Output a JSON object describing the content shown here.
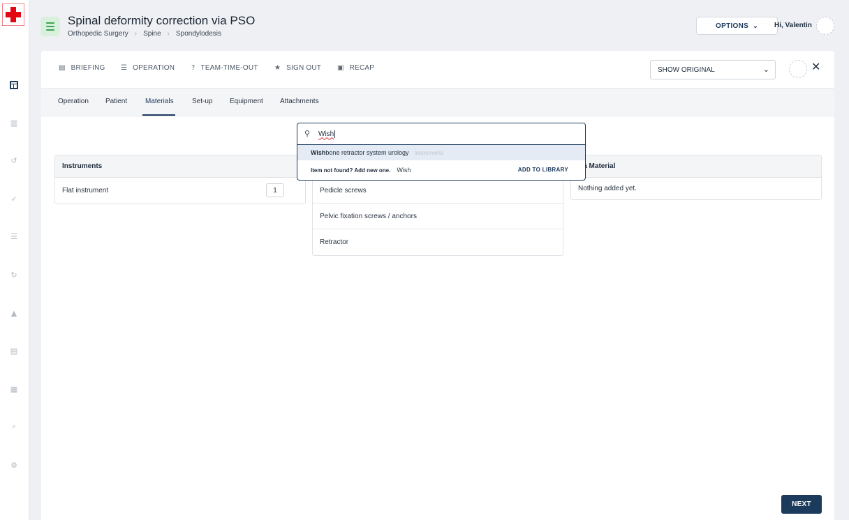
{
  "app": {
    "title": "Spinal deformity correction via PSO",
    "breadcrumbs": [
      "Orthopedic Surgery",
      "Spine",
      "Spondylodesis"
    ],
    "options_label": "OPTIONS",
    "greeting": "Hi, Valentin",
    "brand_color": "#e30613",
    "accent_color": "#1b3a5c"
  },
  "rail": {
    "icons": [
      "dashboard-icon",
      "library-icon",
      "history-icon",
      "checklist-icon",
      "tasks-icon",
      "review-icon",
      "warning-icon",
      "stats-icon",
      "calendar-icon",
      "search-list-icon",
      "settings-icon"
    ]
  },
  "phases": [
    {
      "label": "BRIEFING",
      "icon": "document-icon"
    },
    {
      "label": "OPERATION",
      "icon": "list-icon"
    },
    {
      "label": "TEAM-TIME-OUT",
      "icon": "help-icon"
    },
    {
      "label": "SIGN OUT",
      "icon": "star-icon"
    },
    {
      "label": "RECAP",
      "icon": "recap-icon"
    }
  ],
  "view_select": {
    "value": "SHOW ORIGINAL"
  },
  "tabs": [
    {
      "label": "Operation"
    },
    {
      "label": "Patient"
    },
    {
      "label": "Materials",
      "active": true
    },
    {
      "label": "Set-up"
    },
    {
      "label": "Equipment"
    },
    {
      "label": "Attachments"
    }
  ],
  "search": {
    "value": "Wish",
    "suggestion": {
      "match": "Wish",
      "rest": "bone retractor system urology",
      "category": "Instruments"
    },
    "not_found_label": "Item not found? Add new one.",
    "not_found_term": "Wish",
    "add_label": "ADD TO LIBRARY"
  },
  "panels": {
    "instruments": {
      "title": "Instruments",
      "items": [
        {
          "name": "Flat instrument",
          "qty": "1"
        }
      ]
    },
    "middle": {
      "items": [
        "Pedicle screws",
        "Pelvic fixation screws / anchors",
        "Retractor"
      ]
    },
    "extra": {
      "title_visible": "tra Material",
      "empty_text": "Nothing added yet."
    }
  },
  "next_label": "NEXT"
}
